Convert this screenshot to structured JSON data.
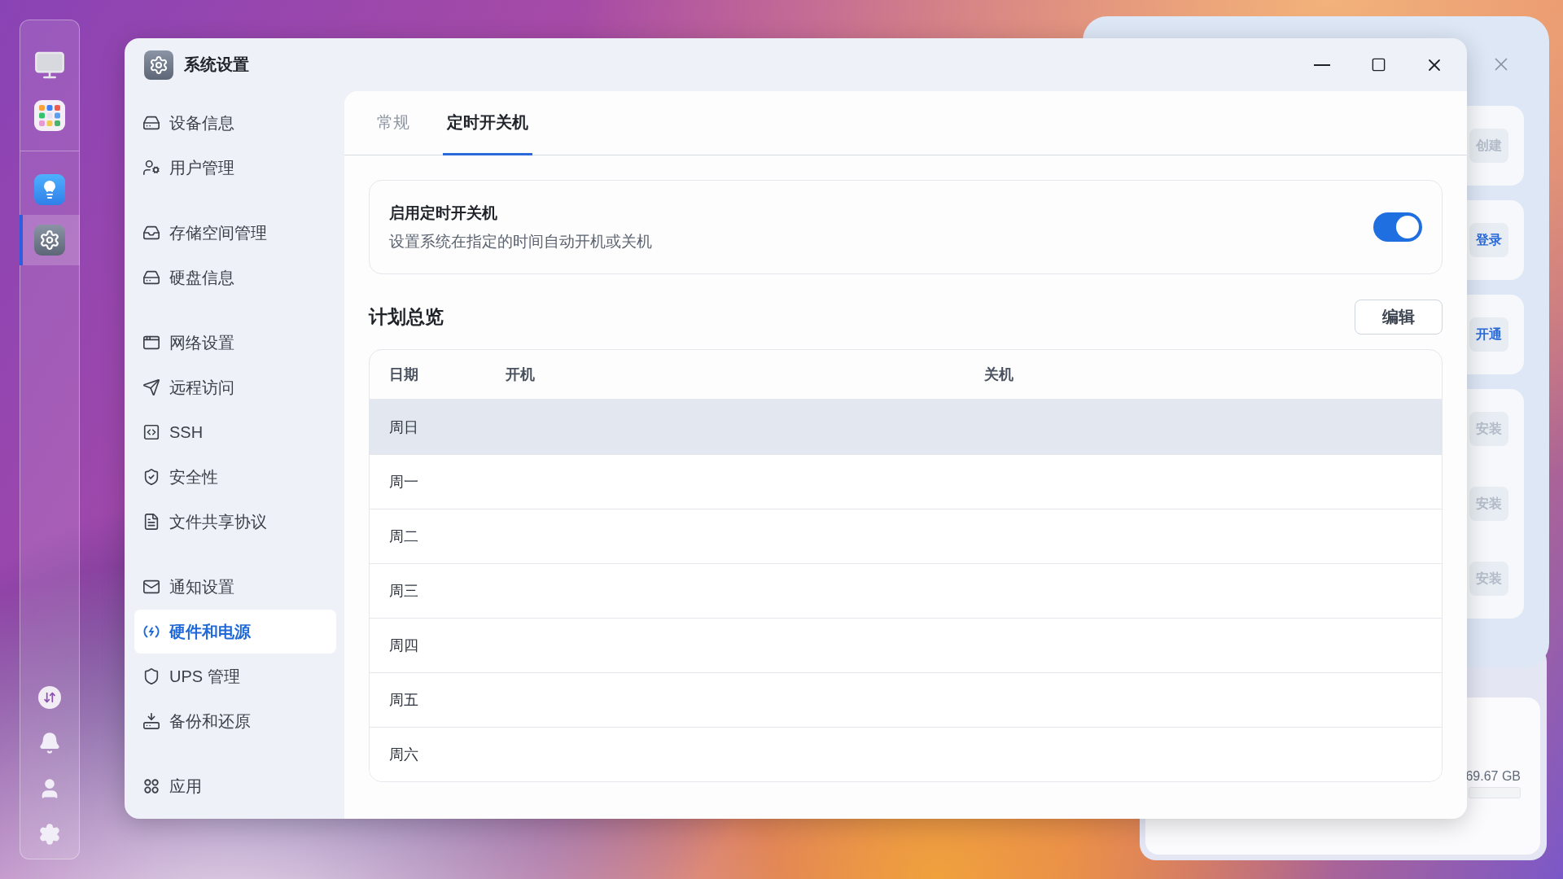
{
  "dock": {
    "apps": [
      {
        "selected": false
      },
      {
        "selected": false
      },
      {
        "selected": false
      },
      {
        "selected": true
      }
    ]
  },
  "window": {
    "title": "系统设置"
  },
  "sidebar": {
    "groups": [
      {
        "items": [
          {
            "label": "设备信息",
            "selected": false
          },
          {
            "label": "用户管理",
            "selected": false
          }
        ]
      },
      {
        "items": [
          {
            "label": "存储空间管理",
            "selected": false
          },
          {
            "label": "硬盘信息",
            "selected": false
          }
        ]
      },
      {
        "items": [
          {
            "label": "网络设置",
            "selected": false
          },
          {
            "label": "远程访问",
            "selected": false
          },
          {
            "label": "SSH",
            "selected": false
          },
          {
            "label": "安全性",
            "selected": false
          },
          {
            "label": "文件共享协议",
            "selected": false
          }
        ]
      },
      {
        "items": [
          {
            "label": "通知设置",
            "selected": false
          },
          {
            "label": "硬件和电源",
            "selected": true
          },
          {
            "label": "UPS 管理",
            "selected": false
          },
          {
            "label": "备份和还原",
            "selected": false
          }
        ]
      },
      {
        "items": [
          {
            "label": "应用",
            "selected": false
          }
        ]
      }
    ]
  },
  "tabs": [
    {
      "label": "常规",
      "selected": false
    },
    {
      "label": "定时开关机",
      "selected": true
    }
  ],
  "schedule_toggle": {
    "title": "启用定时开关机",
    "description": "设置系统在指定的时间自动开机或关机",
    "on": true
  },
  "plan": {
    "title": "计划总览",
    "edit_button": "编辑",
    "table": {
      "columns": [
        "日期",
        "开机",
        "关机"
      ],
      "rows": [
        {
          "day": "周日",
          "selected": true
        },
        {
          "day": "周一",
          "selected": false
        },
        {
          "day": "周二",
          "selected": false
        },
        {
          "day": "周三",
          "selected": false
        },
        {
          "day": "周四",
          "selected": false
        },
        {
          "day": "周五",
          "selected": false
        },
        {
          "day": "周六",
          "selected": false
        }
      ]
    }
  },
  "background_window": {
    "cards": [
      {
        "buttons": [
          {
            "label": "创建",
            "kind": "muted"
          }
        ]
      },
      {
        "buttons": [
          {
            "label": "登录",
            "kind": "primary"
          }
        ]
      },
      {
        "buttons": [
          {
            "label": "开通",
            "kind": "primary"
          }
        ]
      },
      {
        "buttons": [
          {
            "label": "安装",
            "kind": "muted"
          },
          {
            "label": "安装",
            "kind": "muted"
          },
          {
            "label": "安装",
            "kind": "muted"
          }
        ]
      }
    ]
  },
  "storage_card": {
    "reading": "69.67 GB"
  }
}
